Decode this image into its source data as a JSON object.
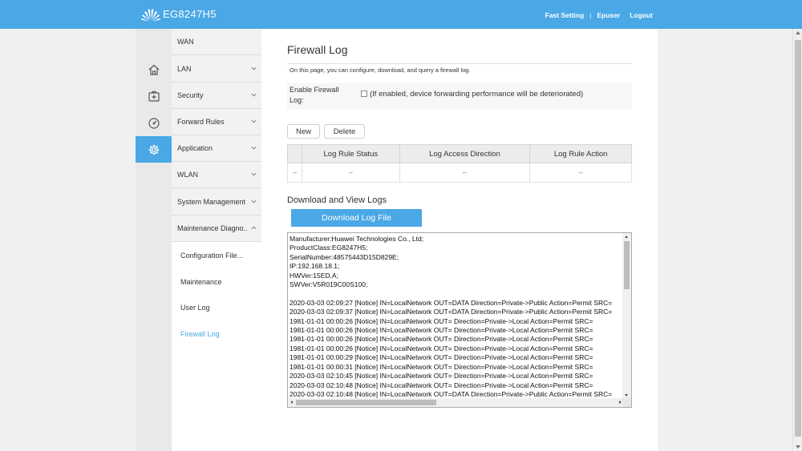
{
  "header": {
    "brand": "EG8247H5",
    "links": {
      "fast_setting": "Fast Setting",
      "separator": "|",
      "user": "Epuser",
      "logout": "Logout"
    }
  },
  "rail": {
    "items": [
      {
        "icon": "home-icon"
      },
      {
        "icon": "medical-kit-icon"
      },
      {
        "icon": "gauge-icon"
      },
      {
        "icon": "gear-icon"
      }
    ],
    "active_index": 3
  },
  "menu": {
    "items": [
      {
        "label": "WAN",
        "expandable": false
      },
      {
        "label": "LAN",
        "expandable": true
      },
      {
        "label": "Security",
        "expandable": true
      },
      {
        "label": "Forward Rules",
        "expandable": true
      },
      {
        "label": "Application",
        "expandable": true
      },
      {
        "label": "WLAN",
        "expandable": true
      },
      {
        "label": "System Management",
        "expandable": true
      },
      {
        "label": "Maintenance Diagno..",
        "expandable": true,
        "expanded": true
      }
    ],
    "subitems": [
      {
        "label": "Configuration File..."
      },
      {
        "label": "Maintenance"
      },
      {
        "label": "User Log"
      },
      {
        "label": "Firewall Log",
        "active": true
      }
    ]
  },
  "page": {
    "title": "Firewall Log",
    "description": "On this page, you can configure, download, and query a firewall log.",
    "enable_label": "Enable Firewall Log:",
    "enable_checked": false,
    "enable_note": "(If enabled, device forwarding performance will be deteriorated)",
    "buttons": {
      "new": "New",
      "delete": "Delete"
    },
    "table": {
      "headers": [
        "",
        "Log Rule Status",
        "Log Access Direction",
        "Log Rule Action"
      ],
      "rows": [
        [
          "--",
          "--",
          "--",
          "--"
        ]
      ]
    },
    "download": {
      "title": "Download and View Logs",
      "button": "Download Log File"
    },
    "log_lines": [
      "Manufacturer:Huawei Technologies Co., Ltd;",
      "ProductClass:EG8247H5;",
      "SerialNumber:48575443D15D829E;",
      "IP:192.168.18.1;",
      "HWVer:15ED.A;",
      "SWVer:V5R019C00S100;",
      "",
      "2020-03-03 02:09:27 [Notice] IN=LocalNetwork OUT=DATA Direction=Private->Public Action=Permit SRC=",
      "2020-03-03 02:09:37 [Notice] IN=LocalNetwork OUT=DATA Direction=Private->Public Action=Permit SRC=",
      "1981-01-01 00:00:26 [Notice] IN=LocalNetwork OUT= Direction=Private->Local Action=Permit SRC=",
      "1981-01-01 00:00:26 [Notice] IN=LocalNetwork OUT= Direction=Private->Local Action=Permit SRC=",
      "1981-01-01 00:00:26 [Notice] IN=LocalNetwork OUT= Direction=Private->Local Action=Permit SRC=",
      "1981-01-01 00:00:26 [Notice] IN=LocalNetwork OUT= Direction=Private->Local Action=Permit SRC=",
      "1981-01-01 00:00:29 [Notice] IN=LocalNetwork OUT= Direction=Private->Local Action=Permit SRC=",
      "1981-01-01 00:00:31 [Notice] IN=LocalNetwork OUT= Direction=Private->Local Action=Permit SRC=",
      "2020-03-03 02:10:45 [Notice] IN=LocalNetwork OUT= Direction=Private->Local Action=Permit SRC=",
      "2020-03-03 02:10:48 [Notice] IN=LocalNetwork OUT= Direction=Private->Local Action=Permit SRC=",
      "2020-03-03 02:10:48 [Notice] IN=LocalNetwork OUT=DATA Direction=Private->Public Action=Permit SRC="
    ]
  },
  "colors": {
    "accent": "#4aa8e6",
    "rail_bg": "#e9e9e9",
    "menu_bg": "#f2f2f2"
  }
}
